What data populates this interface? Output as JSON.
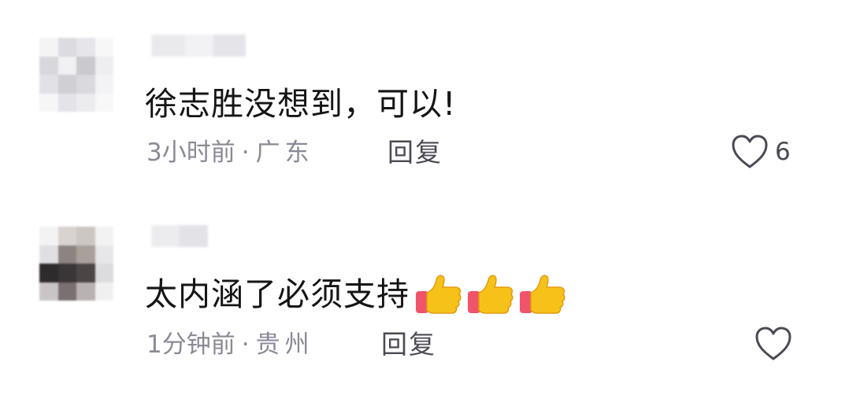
{
  "comments": [
    {
      "text": "徐志胜没想到，可以!",
      "time": "3小时前",
      "separator": "·",
      "location": "广东",
      "reply_label": "回复",
      "like_count": "6",
      "reactions": []
    },
    {
      "text": "太内涵了必须支持",
      "time": "1分钟前",
      "separator": "·",
      "location": "贵州",
      "reply_label": "回复",
      "like_count": "",
      "reactions": [
        "thumbs-up-icon",
        "thumbs-up-icon",
        "thumbs-up-icon"
      ]
    }
  ],
  "colors": {
    "meta_text": "#8a8a96",
    "reply_text": "#4a4a55",
    "heart_outline": "#4a4a55",
    "thumb_yellow": "#f6c21a",
    "thumb_sleeve": "#f0546a"
  }
}
